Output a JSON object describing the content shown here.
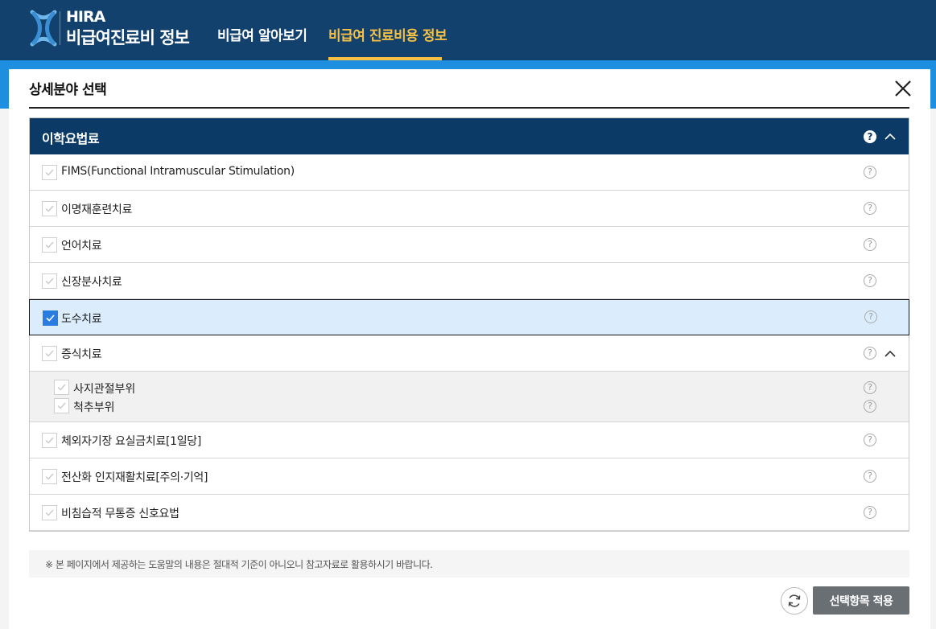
{
  "header": {
    "brand_small": "HIRA",
    "brand_big": "비급여진료비 정보",
    "nav": [
      {
        "label": "비급여 알아보기",
        "active": false
      },
      {
        "label": "비급여 진료비용 정보",
        "active": true
      }
    ],
    "accent_color": "#f6c143",
    "bar_color": "#13416d"
  },
  "modal": {
    "title": "상세분야 선택",
    "category": {
      "title": "이학요법료",
      "help": "?"
    },
    "items": [
      {
        "label": "FIMS(Functional Intramuscular Stimulation)",
        "checked": false
      },
      {
        "label": "이명재훈련치료",
        "checked": false
      },
      {
        "label": "언어치료",
        "checked": false
      },
      {
        "label": "신장분사치료",
        "checked": false
      },
      {
        "label": "도수치료",
        "checked": true
      },
      {
        "label": "증식치료",
        "checked": false,
        "expanded": true
      },
      {
        "label": "체외자기장 요실금치료[1일당]",
        "checked": false
      },
      {
        "label": "전산화 인지재활치료[주의·기억]",
        "checked": false
      },
      {
        "label": "비침습적 무통증 신호요법",
        "checked": false
      }
    ],
    "subitems": [
      {
        "label": "사지관절부위",
        "checked": false
      },
      {
        "label": "척추부위",
        "checked": false
      }
    ],
    "help_glyph": "?",
    "notice": "※ 본 페이지에서 제공하는 도움말의 내용은 절대적 기준이 아니오니 참고자료로 활용하시기 바랍니다.",
    "apply_label": "선택항목 적용",
    "selected_color": "#2a7de0"
  }
}
